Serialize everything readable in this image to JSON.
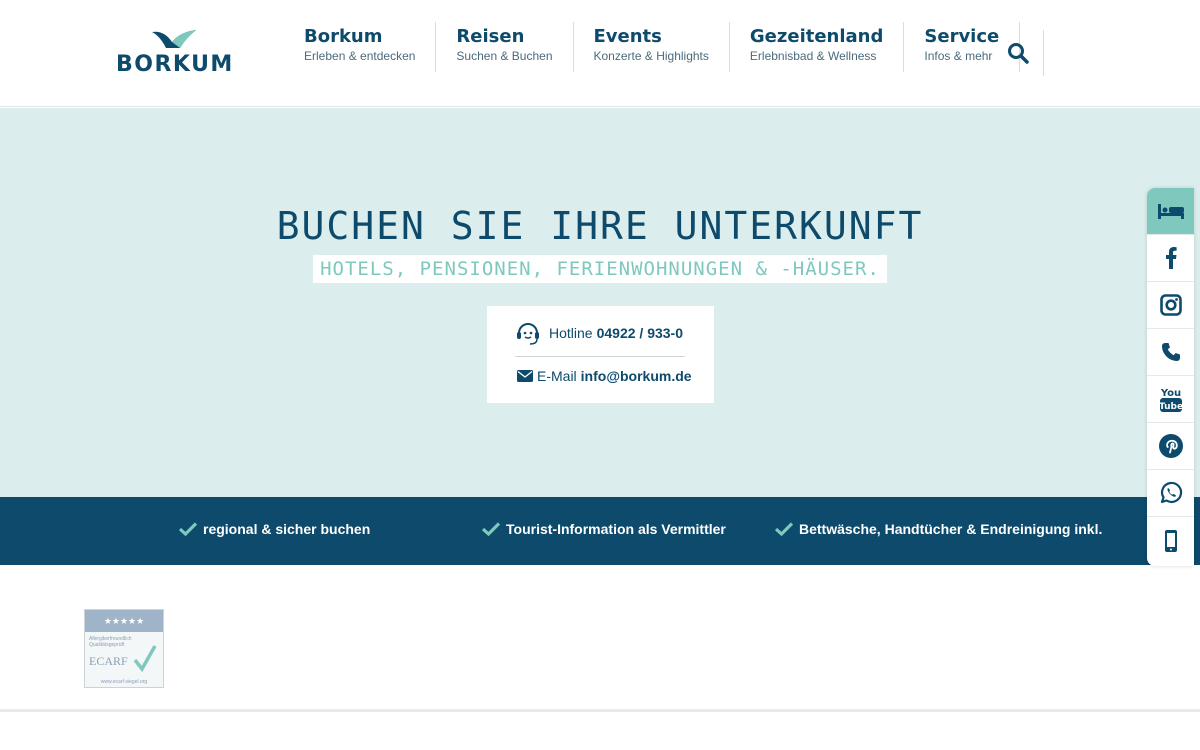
{
  "brand": {
    "name": "BORKUM"
  },
  "nav": [
    {
      "title": "Borkum",
      "sub": "Erleben & entdecken"
    },
    {
      "title": "Reisen",
      "sub": "Suchen & Buchen"
    },
    {
      "title": "Events",
      "sub": "Konzerte & Highlights"
    },
    {
      "title": "Gezeitenland",
      "sub": "Erlebnisbad & Wellness"
    },
    {
      "title": "Service",
      "sub": "Infos & mehr"
    }
  ],
  "search": {
    "icon": "search-icon"
  },
  "hero": {
    "title": "BUCHEN SIE IHRE UNTERKUNFT",
    "subtitle": "HOTELS, PENSIONEN, FERIENWOHNUNGEN & -HÄUSER."
  },
  "contact": {
    "hotline_label": "Hotline",
    "hotline_number": "04922 / 933-0",
    "mail_label": "E-Mail",
    "mail_address": "info@borkum.de"
  },
  "features": [
    "regional & sicher buchen",
    "Tourist-Information als Vermittler",
    "Bettwäsche, Handtücher & Endreinigung inkl."
  ],
  "sidebar": [
    "bed-icon",
    "facebook-icon",
    "instagram-icon",
    "phone-icon",
    "youtube-icon",
    "pinterest-icon",
    "whatsapp-icon",
    "mobile-icon"
  ],
  "seal": {
    "stars": "★★★★★",
    "line1": "Allergikerfreundlich",
    "line2": "Qualitätsgeprüft",
    "brand": "ECARF",
    "url": "www.ecarf-siegel.org"
  },
  "colors": {
    "primary": "#0d4a6b",
    "accent": "#7ec8be",
    "hero_bg": "#dbeeed"
  }
}
